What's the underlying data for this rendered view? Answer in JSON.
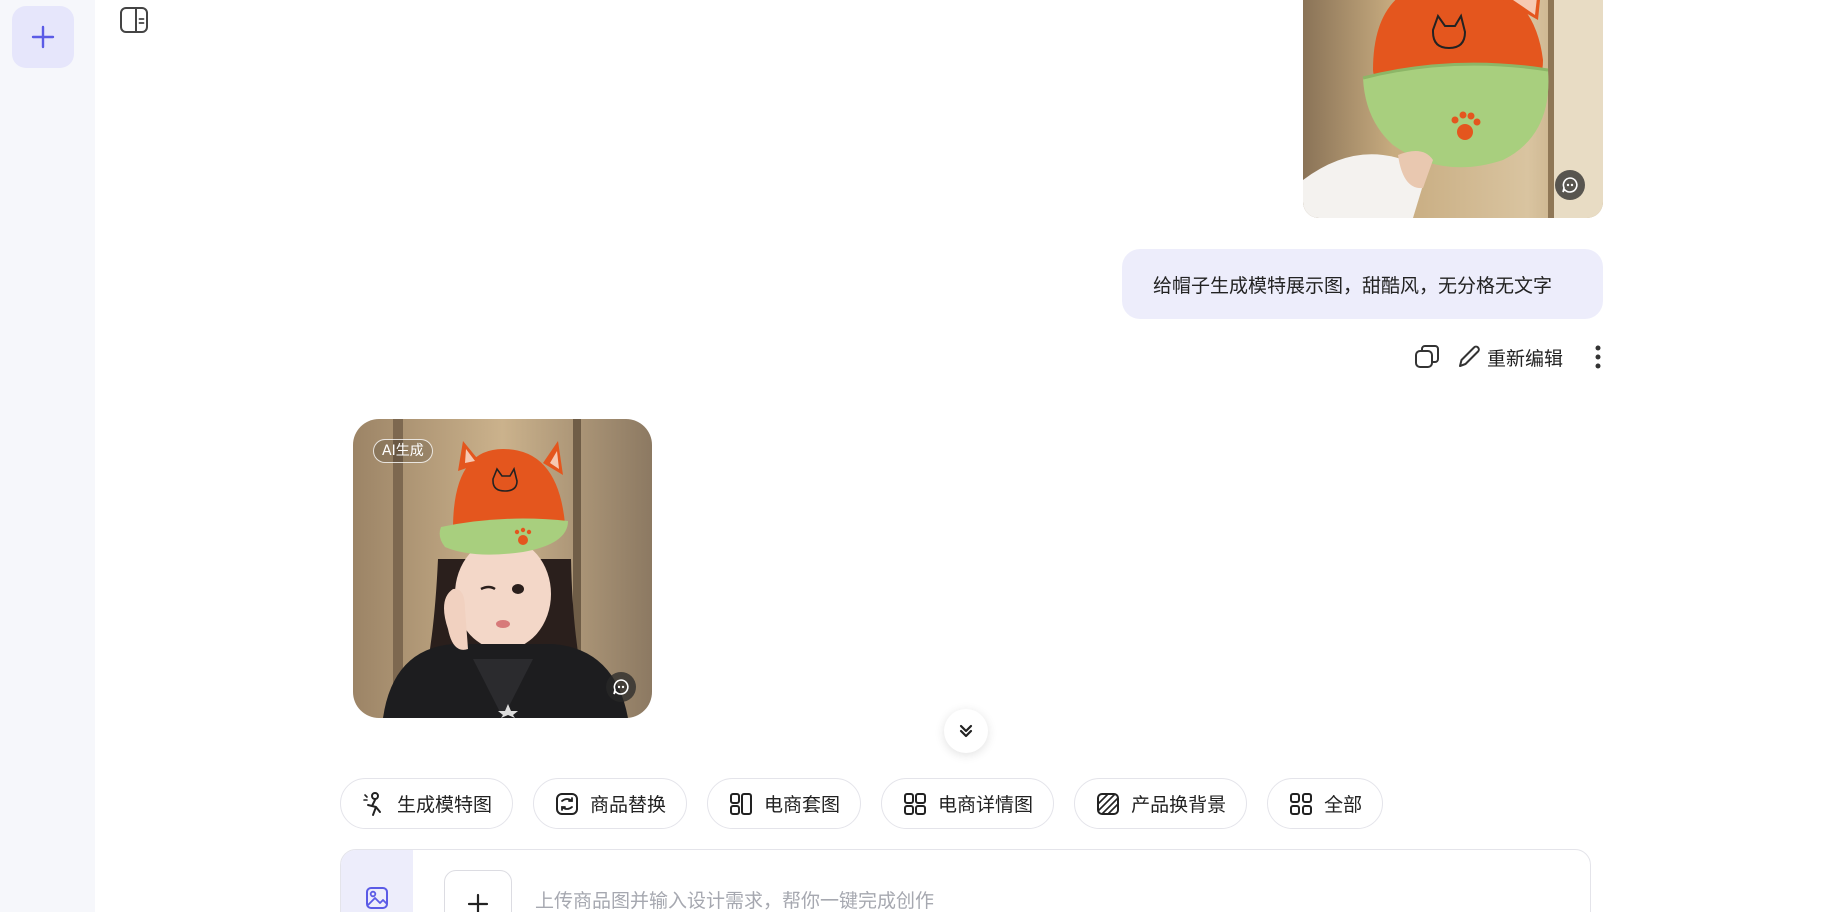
{
  "sidebar": {
    "new_chat_icon": "plus-icon",
    "panel_toggle_icon": "panel-layout-icon"
  },
  "conversation": {
    "user_message": {
      "text": "给帽子生成模特展示图，甜酷风，无分格无文字",
      "actions": {
        "copy_icon": "copy-icon",
        "edit_label": "重新编辑",
        "more_icon": "more-vertical-icon"
      }
    },
    "ai_result": {
      "badge": "AI生成"
    }
  },
  "quick_actions": [
    {
      "label": "生成模特图",
      "icon": "model-person-icon"
    },
    {
      "label": "商品替换",
      "icon": "product-swap-icon"
    },
    {
      "label": "电商套图",
      "icon": "grid-layout-icon"
    },
    {
      "label": "电商详情图",
      "icon": "grid-detail-icon"
    },
    {
      "label": "产品换背景",
      "icon": "background-hatch-icon"
    },
    {
      "label": "全部",
      "icon": "all-grid-icon"
    }
  ],
  "composer": {
    "placeholder": "上传商品图并输入设计需求，帮你一键完成创作",
    "value": ""
  },
  "colors": {
    "accent": "#5b5be6",
    "bubble": "#ededfb",
    "rail": "#f6f7fb"
  }
}
